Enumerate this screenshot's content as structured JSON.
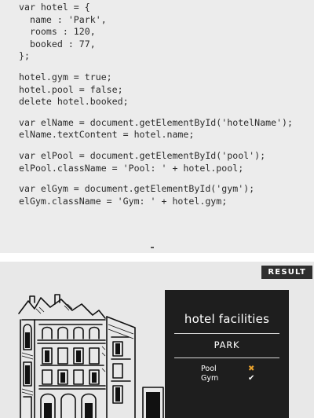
{
  "code": {
    "groups": [
      [
        "var hotel = {",
        "  name : 'Park',",
        "  rooms : 120,",
        "  booked : 77,",
        "};"
      ],
      [
        "hotel.gym = true;",
        "hotel.pool = false;",
        "delete hotel.booked;"
      ],
      [
        "var elName = document.getElementById('hotelName');",
        "elName.textContent = hotel.name;"
      ],
      [
        "var elPool = document.getElementById('pool');",
        "elPool.className = 'Pool: ' + hotel.pool;"
      ],
      [
        "var elGym = document.getElementById('gym');",
        "elGym.className = 'Gym: ' + hotel.gym;"
      ]
    ]
  },
  "result": {
    "tab_label": "RESULT",
    "facilities": {
      "title": "hotel facilities",
      "hotel_name": "PARK",
      "items": [
        {
          "label": "Pool",
          "mark": "✖",
          "mark_icon": "cross-icon",
          "color": "#e8a12c"
        },
        {
          "label": "Gym",
          "mark": "✔",
          "mark_icon": "check-icon",
          "color": "#ffffff"
        }
      ]
    }
  }
}
